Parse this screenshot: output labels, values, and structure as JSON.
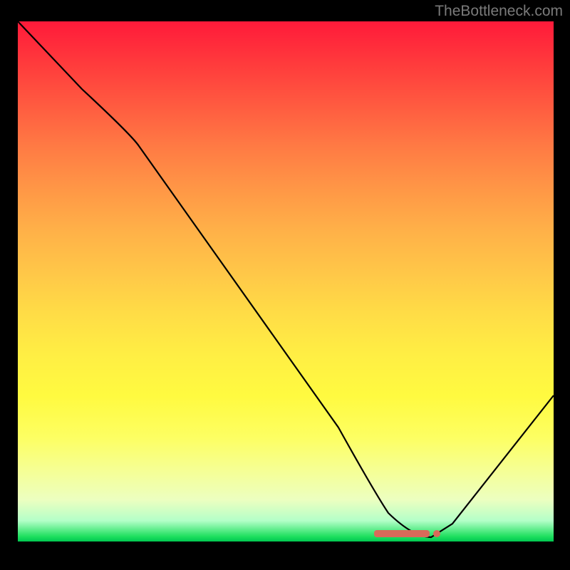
{
  "watermark": "TheBottleneck.com",
  "chart_data": {
    "type": "line",
    "title": "",
    "xlabel": "",
    "ylabel": "",
    "xlim": [
      0,
      100
    ],
    "ylim": [
      0,
      100
    ],
    "background": "vertical-gradient red-yellow-green",
    "series": [
      {
        "name": "bottleneck-curve",
        "color": "#000000",
        "x": [
          0,
          12,
          22,
          60,
          66,
          73,
          78,
          82,
          100
        ],
        "values": [
          100,
          87,
          78,
          22,
          8,
          1,
          1,
          4,
          28
        ]
      }
    ],
    "annotations": [
      {
        "name": "optimal-range-marker",
        "x_start": 66,
        "x_end": 77,
        "y": 1.5,
        "color": "#d96a5a"
      }
    ]
  }
}
